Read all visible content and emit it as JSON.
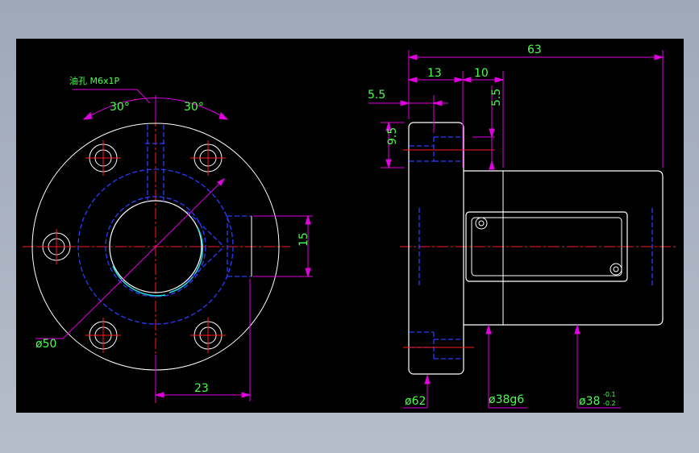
{
  "colors": {
    "background": "#000000",
    "outline": "#ffffff",
    "hidden": "#2a3cff",
    "centerline": "#ff1a1a",
    "dimension": "#e000e0",
    "dimension_text": "#4cff4c",
    "cyan_arc": "#22dddd"
  },
  "front_view": {
    "oil_hole_note": "油孔 M6x1P",
    "angle_left": "30°",
    "angle_right": "30°",
    "dia_pcd": "ø50",
    "dim_flat": "15",
    "dim_offset": "23"
  },
  "side_view": {
    "dim_total": "63",
    "dim_flange": "13",
    "dim_step": "10",
    "dim_hole_pos": "5.5",
    "dim_hole_depth": "5.5",
    "dim_counterbore": "9.5",
    "dia_flange": "ø62",
    "dia_body": "ø38g6",
    "dia_nut": "ø38",
    "tol_upper": "-0.1",
    "tol_lower": "-0.2"
  }
}
